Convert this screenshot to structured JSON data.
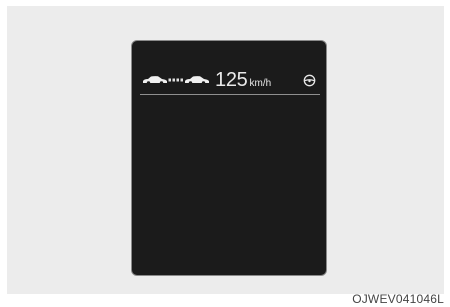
{
  "display": {
    "set_speed": {
      "value": "125",
      "unit": "km/h"
    },
    "icons": {
      "lead_vehicle": "front-car-icon",
      "distance": "following-distance-icon",
      "own_vehicle": "own-car-icon",
      "steering": "steering-wheel-icon"
    }
  },
  "image_code": "OJWEV041046L"
}
